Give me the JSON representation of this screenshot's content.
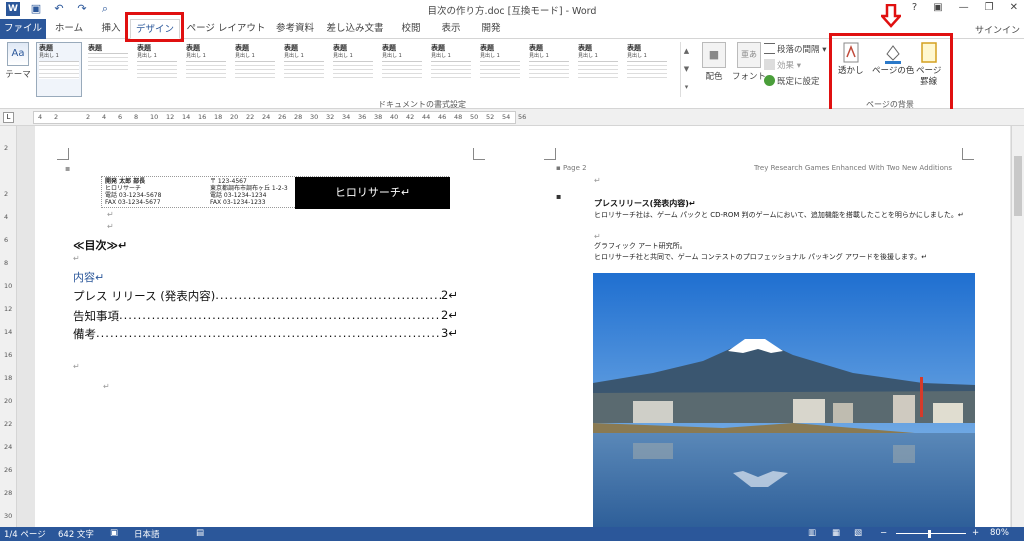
{
  "titlebar": {
    "title": "目次の作り方.doc [互換モード] - Word",
    "help": "?",
    "ribbon_display": "▣",
    "minimize": "—",
    "restore": "❐",
    "close": "✕"
  },
  "tabs": {
    "file": "ファイル",
    "home": "ホーム",
    "insert": "挿入",
    "design": "デザイン",
    "layout": "ページ レイアウト",
    "references": "参考資料",
    "mailings": "差し込み文書",
    "review": "校閲",
    "view": "表示",
    "developer": "開発",
    "signin": "サインイン"
  },
  "ribbon": {
    "theme_label": "テーマ",
    "gallery": [
      {
        "h": "表題",
        "s": "見出し 1",
        "selected": true
      },
      {
        "h": "表題",
        "s": ""
      },
      {
        "h": "表題",
        "s": "見出し 1"
      },
      {
        "h": "表題",
        "s": "見出し 1"
      },
      {
        "h": "表題",
        "s": "見出し 1"
      },
      {
        "h": "表題",
        "s": "見出し 1"
      },
      {
        "h": "表題",
        "s": "見出し 1"
      },
      {
        "h": "表題",
        "s": "見出し 1"
      },
      {
        "h": "表題",
        "s": "見出し 1"
      },
      {
        "h": "表題",
        "s": "見出し 1"
      },
      {
        "h": "表題",
        "s": "見出し 1"
      },
      {
        "h": "表題",
        "s": "見出し 1"
      },
      {
        "h": "表題",
        "s": "見出し 1"
      }
    ],
    "colors_label": "配色",
    "fonts_label": "フォント",
    "paragraph_spacing": "段落の間隔",
    "effects": "効果",
    "set_default": "既定に設定",
    "doc_format_group": "ドキュメントの書式設定",
    "watermark": "透かし",
    "page_color": "ページの色",
    "page_borders_1": "ページ",
    "page_borders_2": "罫線",
    "page_bg_group": "ページの背景",
    "highlight_color": "#e01010"
  },
  "ruler": [
    "4",
    "2",
    "",
    "2",
    "4",
    "6",
    "8",
    "10",
    "12",
    "14",
    "16",
    "18",
    "20",
    "22",
    "24",
    "26",
    "28",
    "30",
    "32",
    "34",
    "36",
    "38",
    "40",
    "42",
    "44",
    "46",
    "48",
    "50",
    "52",
    "54",
    "56"
  ],
  "vruler": [
    "2",
    "",
    "2",
    "4",
    "6",
    "8",
    "10",
    "12",
    "14",
    "16",
    "18",
    "20",
    "22",
    "24",
    "26",
    "28",
    "30"
  ],
  "left_page": {
    "letterhead": {
      "col1_1": "開発 太郎 部長",
      "col1_2": "ヒロリサーチ",
      "col1_3": "電話 03-1234-5678",
      "col1_4": "FAX 03-1234-5677",
      "col2_1": "〒 123-4567",
      "col2_2": "東京都調布市調布ヶ丘 1-2-3",
      "col2_3": "電話 03-1234-1234",
      "col2_4": "FAX 03-1234-1233",
      "company": "ヒロリサーチ↵"
    },
    "toc_title": "≪目次≫↵",
    "toc_heading": "内容↵",
    "toc_entries": [
      {
        "text": "プレス リリース (発表内容)",
        "page": "2↵"
      },
      {
        "text": "告知事項",
        "page": "2↵"
      },
      {
        "text": "備考",
        "page": "3↵"
      }
    ]
  },
  "right_page": {
    "header_left": "▪ Page 2",
    "header_right": "Trey Research Games Enhanced With Two New Additions",
    "heading": "プレスリリース(発表内容)↵",
    "p1": "ヒロリサーチ社は、ゲーム パックと CD-ROM 判のゲームにおいて、追加機能を搭載したことを明らかにしました。↵",
    "p2": "グラフィック アート研究所。",
    "p3": "ヒロリサーチ社と共同で、ゲーム コンテストのプロフェッショナル パッキング アワードを後援します。↵"
  },
  "status": {
    "pages": "1/4 ページ",
    "words": "642 文字",
    "lang": "日本語",
    "zoom": "80%"
  }
}
